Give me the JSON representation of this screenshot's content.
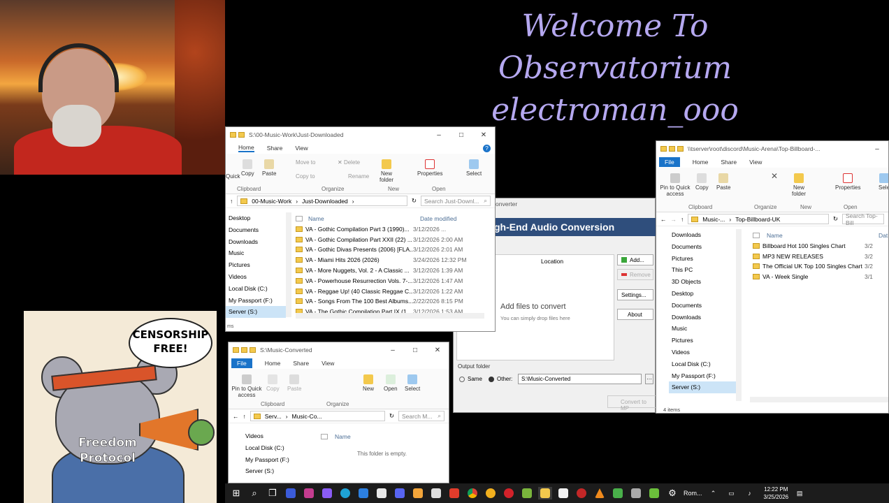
{
  "banner": {
    "line1": "Welcome To Observatorium",
    "line2": "electroman_ooo"
  },
  "poster": {
    "bubble": "CENSORSHIP FREE!",
    "hoodie_line1": "Freedom",
    "hoodie_line2": "Protocol"
  },
  "win_downloaded": {
    "title": "S:\\00-Music-Work\\Just-Downloaded",
    "tabs": [
      "Home",
      "Share",
      "View"
    ],
    "ribbon": {
      "pin": "Quick",
      "copy": "Copy",
      "paste": "Paste",
      "move_to": "Move to",
      "delete": "Delete",
      "copy_to": "Copy to",
      "rename": "Rename",
      "new_folder": "New folder",
      "properties": "Properties",
      "select": "Select",
      "g_clipboard": "Clipboard",
      "g_organize": "Organize",
      "g_new": "New",
      "g_open": "Open"
    },
    "path": [
      "00-Music-Work",
      "Just-Downloaded"
    ],
    "search_placeholder": "Search Just-Downl...",
    "nav": [
      "Desktop",
      "Documents",
      "Downloads",
      "Music",
      "Pictures",
      "Videos",
      "Local Disk (C:)",
      "My Passport (F:)",
      "Server (S:)"
    ],
    "col_name": "Name",
    "col_date": "Date modified",
    "rows": [
      {
        "name": "VA - Gothic Compilation Part 3 (1990)...",
        "date": "3/12/2026 ..."
      },
      {
        "name": "VA - Gothic Compilation Part XXII (22) ...",
        "date": "3/12/2026 2:00 AM"
      },
      {
        "name": "VA - Gothic Divas Presents (2006) [FLA...",
        "date": "3/12/2026 2:01 AM"
      },
      {
        "name": "VA - Miami Hits 2026 (2026)",
        "date": "3/24/2026 12:32 PM"
      },
      {
        "name": "VA - More Nuggets, Vol. 2 - A Classic ...",
        "date": "3/12/2026 1:39 AM"
      },
      {
        "name": "VA - Powerhouse Resurrection Vols. 7-...",
        "date": "3/12/2026 1:47 AM"
      },
      {
        "name": "VA - Reggae Up! (40 Classic Reggae C...",
        "date": "3/12/2026 1:22 AM"
      },
      {
        "name": "VA - Songs From The 100 Best Albums...",
        "date": "2/22/2026 8:15 PM"
      },
      {
        "name": "VA - The Gothic Compilation Part IX (1...",
        "date": "3/12/2026 1:53 AM"
      }
    ],
    "status": "ms"
  },
  "win_converted": {
    "title": "S:\\Music-Converted",
    "tabs": [
      "File",
      "Home",
      "Share",
      "View"
    ],
    "ribbon": {
      "pin": "Pin to Quick access",
      "copy": "Copy",
      "paste": "Paste",
      "new": "New",
      "open": "Open",
      "select": "Select",
      "g_clipboard": "Clipboard",
      "g_organize": "Organize"
    },
    "path": [
      "Serv...",
      "Music-Co..."
    ],
    "search_placeholder": "Search M...",
    "nav": [
      "Videos",
      "Local Disk (C:)",
      "My Passport (F:)",
      "Server (S:)"
    ],
    "col_name": "Name",
    "empty": "This folder is empty."
  },
  "converter": {
    "title": "onverter",
    "band": "gh-End Audio Conversion",
    "col_location": "Location",
    "add": "Add...",
    "remove": "Remove",
    "settings": "Settings...",
    "about": "About",
    "add_files": "Add files to convert",
    "drop_hint": "You can simply drop files here",
    "output_label": "Output folder",
    "same": "Same",
    "other": "Other:",
    "output_path": "S:\\Music-Converted",
    "convert": "Convert to MP"
  },
  "win_billboard": {
    "title": "\\\\tserver\\root\\discord\\Music-Arena\\Top-Billboard-...",
    "tabs": [
      "File",
      "Home",
      "Share",
      "View"
    ],
    "ribbon": {
      "pin": "Pin to Quick access",
      "copy": "Copy",
      "paste": "Paste",
      "new_folder": "New folder",
      "properties": "Properties",
      "select": "Sele",
      "g_clipboard": "Clipboard",
      "g_organize": "Organize",
      "g_new": "New",
      "g_open": "Open"
    },
    "path": [
      "Music-...",
      "Top-Billboard-UK"
    ],
    "search_placeholder": "Search Top-Bill",
    "nav": [
      "Downloads",
      "Documents",
      "Pictures",
      "This PC",
      "3D Objects",
      "Desktop",
      "Documents",
      "Downloads",
      "Music",
      "Pictures",
      "Videos",
      "Local Disk (C:)",
      "My Passport (F:)",
      "Server (S:)"
    ],
    "col_name": "Name",
    "col_date": "Dat",
    "rows": [
      {
        "name": "Billboard Hot 100 Singles Chart",
        "date": "3/2"
      },
      {
        "name": "MP3 NEW RELEASES",
        "date": "3/2"
      },
      {
        "name": "The Official UK Top 100 Singles Chart",
        "date": "3/2"
      },
      {
        "name": "VA - Week Single",
        "date": "3/1"
      }
    ],
    "status": "4 items"
  },
  "taskbar": {
    "lang": "Rom...",
    "time": "12:22 PM",
    "date": "3/25/2026"
  }
}
